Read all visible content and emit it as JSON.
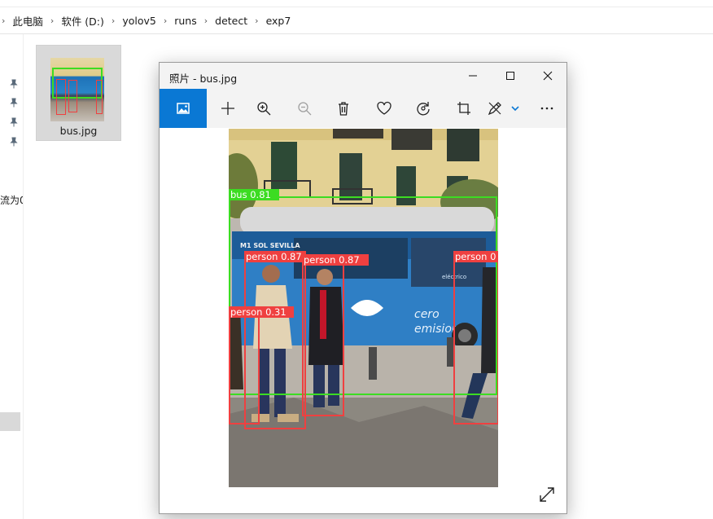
{
  "explorer": {
    "breadcrumbs": [
      "此电脑",
      "软件 (D:)",
      "yolov5",
      "runs",
      "detect",
      "exp7"
    ],
    "separator": "›",
    "nav_truncated_text": "流为0",
    "file": {
      "name": "bus.jpg"
    }
  },
  "photos": {
    "title": "照片 - bus.jpg",
    "accent_color": "#0a78d4",
    "toolbar": [
      "image-icon",
      "add-icon",
      "zoom-in-icon",
      "zoom-out-icon",
      "delete-icon",
      "favorite-heart-icon",
      "rotate-icon",
      "crop-icon",
      "edit-icon",
      "chevron-down-icon",
      "more-icon"
    ],
    "detections": [
      {
        "label": "bus 0.81",
        "color": "#3cdc22"
      },
      {
        "label": "person 0.87",
        "color": "#ef4040"
      },
      {
        "label": "person 0.87",
        "color": "#ef4040"
      },
      {
        "label": "person 0.31",
        "color": "#ef4040"
      },
      {
        "label": "person 0",
        "color": "#ef4040"
      }
    ],
    "bus_ad": {
      "line1": "cero",
      "line2": "emisiones",
      "logo": "eléctrico",
      "route": "M1 SOL SEVILLA"
    }
  }
}
